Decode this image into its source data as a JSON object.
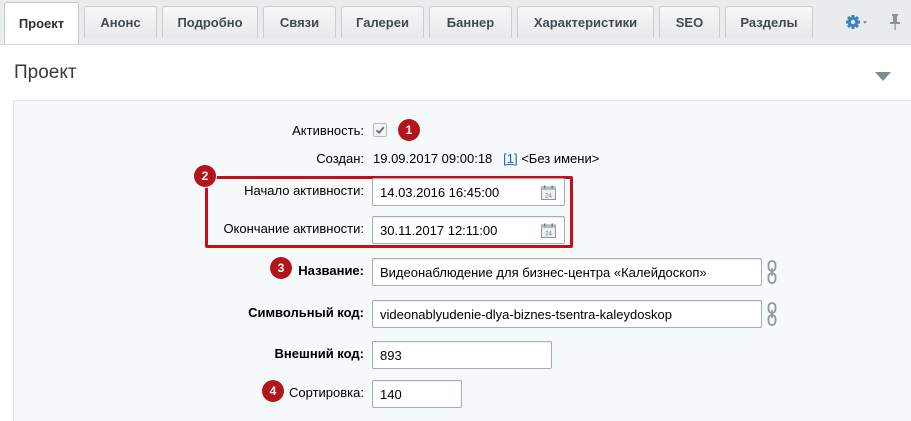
{
  "tabs": [
    {
      "label": "Проект",
      "active": true
    },
    {
      "label": "Анонс"
    },
    {
      "label": "Подробно"
    },
    {
      "label": "Связи"
    },
    {
      "label": "Галереи"
    },
    {
      "label": "Баннер"
    },
    {
      "label": "Характеристики"
    },
    {
      "label": "SEO"
    },
    {
      "label": "Разделы"
    }
  ],
  "section": {
    "title": "Проект"
  },
  "form": {
    "active": {
      "label": "Активность:",
      "checked": true
    },
    "created": {
      "label": "Создан:",
      "date": "19.09.2017 09:00:18",
      "user_id": "[1]",
      "user_name": "<Без имени>"
    },
    "active_from": {
      "label": "Начало активности:",
      "value": "14.03.2016 16:45:00"
    },
    "active_to": {
      "label": "Окончание активности:",
      "value": "30.11.2017 12:11:00"
    },
    "name": {
      "label": "Название:",
      "value": "Видеонаблюдение для бизнес-центра «Калейдоскоп»"
    },
    "code": {
      "label": "Символьный код:",
      "value": "videonablyudenie-dlya-biznes-tsentra-kaleydoskop"
    },
    "xml_id": {
      "label": "Внешний код:",
      "value": "893"
    },
    "sort": {
      "label": "Сортировка:",
      "value": "140"
    }
  },
  "badges": [
    "1",
    "2",
    "3",
    "4"
  ],
  "colors": {
    "badge": "#b4141b",
    "highlight": "#c0101a",
    "link": "#2067b0",
    "gear": "#3a7fc1"
  },
  "icons": [
    "gear-icon",
    "pin-icon",
    "chevron-down-icon",
    "calendar-icon",
    "chain-link-icon",
    "checkmark-icon"
  ]
}
